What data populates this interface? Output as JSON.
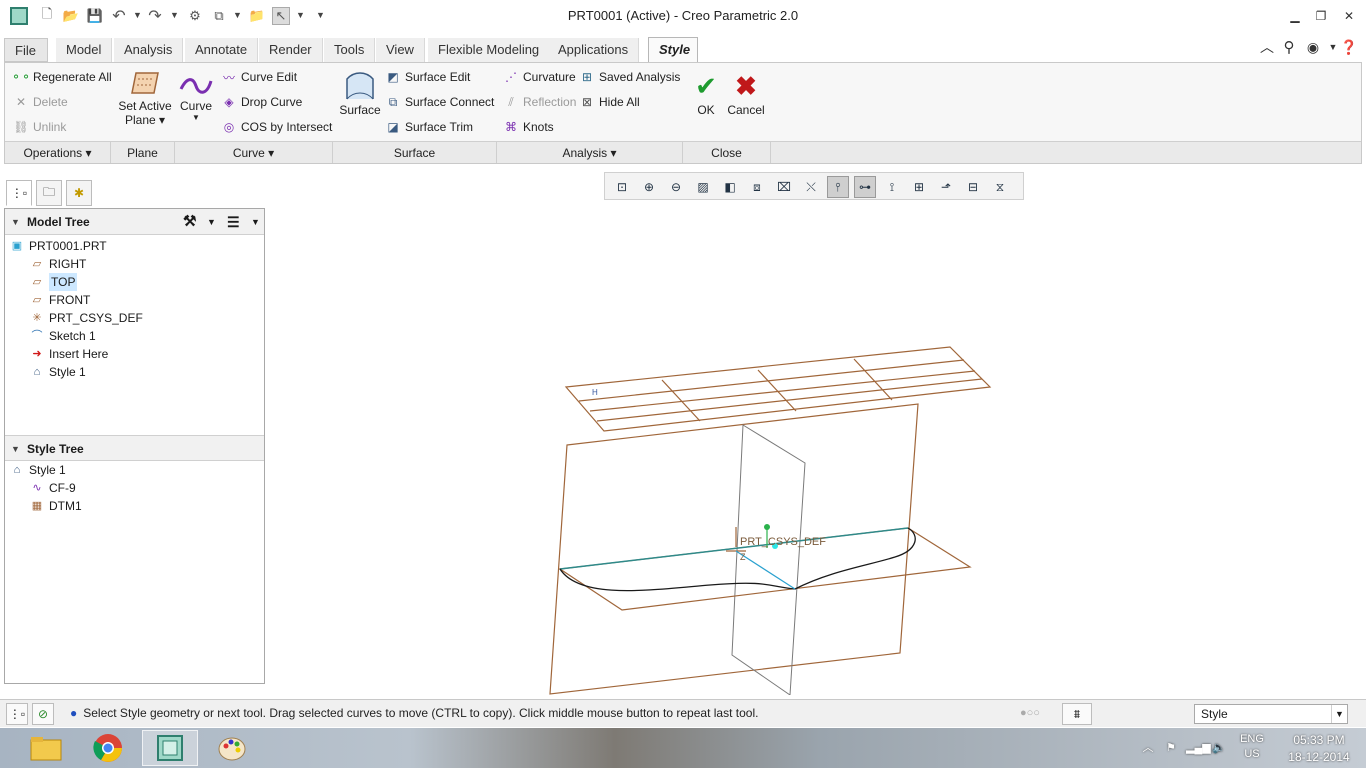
{
  "window": {
    "title": "PRT0001 (Active) - Creo Parametric 2.0",
    "app_icon": "creo-app-icon",
    "quick_access": [
      "new-icon",
      "open-icon",
      "save-icon",
      "undo-icon",
      "redo-icon",
      "regenerate-icon",
      "window-icon",
      "close-window-icon",
      "select-icon"
    ],
    "controls": [
      "minimize-icon",
      "restore-icon",
      "close-icon"
    ]
  },
  "ribbon": {
    "file_label": "File",
    "tabs": [
      {
        "label": "Model"
      },
      {
        "label": "Analysis"
      },
      {
        "label": "Annotate"
      },
      {
        "label": "Render"
      },
      {
        "label": "Tools"
      },
      {
        "label": "View"
      },
      {
        "label": "Flexible Modeling"
      },
      {
        "label": "Applications"
      },
      {
        "label": "Style"
      }
    ],
    "active_tab": "Style",
    "right_icons": [
      "collapse-ribbon-icon",
      "search-icon",
      "help-icon"
    ],
    "groups": {
      "operations": {
        "label": "Operations",
        "items": [
          {
            "label": "Regenerate All",
            "icon": "regenerate-icon",
            "enabled": true
          },
          {
            "label": "Delete",
            "icon": "delete-icon",
            "enabled": false
          },
          {
            "label": "Unlink",
            "icon": "unlink-icon",
            "enabled": false
          }
        ]
      },
      "plane": {
        "label": "Plane",
        "set_active_plane": {
          "line1": "Set Active",
          "line2": "Plane"
        }
      },
      "curve": {
        "label": "Curve",
        "big_label": "Curve",
        "items": [
          {
            "label": "Curve Edit",
            "icon": "curve-edit-icon"
          },
          {
            "label": "Drop Curve",
            "icon": "drop-curve-icon"
          },
          {
            "label": "COS by Intersect",
            "icon": "cos-intersect-icon"
          }
        ]
      },
      "surface": {
        "label": "Surface",
        "big_label": "Surface",
        "items": [
          {
            "label": "Surface Edit",
            "icon": "surface-edit-icon"
          },
          {
            "label": "Surface Connect",
            "icon": "surface-connect-icon"
          },
          {
            "label": "Surface Trim",
            "icon": "surface-trim-icon"
          }
        ]
      },
      "analysis": {
        "label": "Analysis",
        "col1": [
          {
            "label": "Curvature",
            "icon": "curvature-icon",
            "enabled": true
          },
          {
            "label": "Reflection",
            "icon": "reflection-icon",
            "enabled": false
          },
          {
            "label": "Knots",
            "icon": "knots-icon",
            "enabled": true
          }
        ],
        "col2": [
          {
            "label": "Saved Analysis",
            "icon": "saved-analysis-icon"
          },
          {
            "label": "Hide All",
            "icon": "hide-all-icon"
          }
        ]
      },
      "close": {
        "label": "Close",
        "ok": "OK",
        "cancel": "Cancel"
      }
    }
  },
  "view_toolbar": {
    "buttons": [
      {
        "icon": "refit-icon",
        "on": false
      },
      {
        "icon": "zoom-in-icon",
        "on": false
      },
      {
        "icon": "zoom-out-icon",
        "on": false
      },
      {
        "icon": "repaint-icon",
        "on": false
      },
      {
        "icon": "display-style-icon",
        "on": false
      },
      {
        "icon": "saved-orientations-icon",
        "on": false
      },
      {
        "icon": "view-manager-icon",
        "on": false
      },
      {
        "icon": "plane-display-icon",
        "on": false
      },
      {
        "icon": "axis-display-icon",
        "on": true
      },
      {
        "icon": "point-display-icon",
        "on": true
      },
      {
        "icon": "csys-display-icon",
        "on": false
      },
      {
        "icon": "spin-center-icon",
        "on": false
      },
      {
        "icon": "annotation-display-icon",
        "on": false
      },
      {
        "icon": "grid-display-icon",
        "on": false
      },
      {
        "icon": "mirror-display-icon",
        "on": false
      }
    ]
  },
  "left_panel": {
    "tabs": [
      "model-tree-tab-icon",
      "folder-browser-tab-icon",
      "favorites-tab-icon"
    ],
    "model_tree": {
      "title": "Model Tree",
      "items": [
        {
          "label": "PRT0001.PRT",
          "icon": "part-icon",
          "indent": 0,
          "selected": false
        },
        {
          "label": "RIGHT",
          "icon": "datum-plane-icon",
          "indent": 1,
          "selected": false
        },
        {
          "label": "TOP",
          "icon": "datum-plane-icon",
          "indent": 1,
          "selected": true
        },
        {
          "label": "FRONT",
          "icon": "datum-plane-icon",
          "indent": 1,
          "selected": false
        },
        {
          "label": "PRT_CSYS_DEF",
          "icon": "csys-icon",
          "indent": 1,
          "selected": false
        },
        {
          "label": "Sketch 1",
          "icon": "sketch-icon",
          "indent": 1,
          "selected": false
        },
        {
          "label": "Insert Here",
          "icon": "insert-here-icon",
          "indent": 1,
          "selected": false
        },
        {
          "label": "Style 1",
          "icon": "style-feature-icon",
          "indent": 1,
          "selected": false
        }
      ]
    },
    "style_tree": {
      "title": "Style Tree",
      "items": [
        {
          "label": "Style 1",
          "icon": "style-feature-icon",
          "indent": 0
        },
        {
          "label": "CF-9",
          "icon": "free-curve-icon",
          "indent": 1
        },
        {
          "label": "DTM1",
          "icon": "datum-plane-icon",
          "indent": 1
        }
      ]
    }
  },
  "graphics": {
    "csys_label": "PRT_CSYS_DEF",
    "colors": {
      "datum": "#a0663a",
      "curve": "#1a1a1a",
      "active_plane_edge": "#2f8a8a",
      "axis_x": "#2aa1cf",
      "axis_y": "#2bb24c"
    }
  },
  "status_bar": {
    "message": "Select Style geometry or next tool. Drag selected curves to move (CTRL to copy). Click middle mouse button to repeat last tool.",
    "filter_value": "Style",
    "left_icons": [
      "toggle-navigator-icon",
      "toggle-browser-icon"
    ],
    "right_icons": [
      "regen-status-icon",
      "find-icon"
    ]
  },
  "taskbar": {
    "apps": [
      "file-explorer-icon",
      "chrome-icon",
      "creo-taskbar-icon",
      "paint-icon"
    ],
    "tray": {
      "lang_line1": "ENG",
      "lang_line2": "US",
      "time": "05:33 PM",
      "date": "18-12-2014"
    }
  }
}
